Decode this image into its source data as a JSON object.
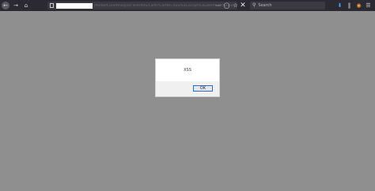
{
  "toolbar": {
    "back_icon": "arrow-left-icon",
    "forward_icon": "arrow-right-icon",
    "home_icon": "home-icon",
    "url_text": "/Portal/Core/Analysis/Test/XSS/Cart/?CartId=XSS%3Cscript%3Ealert%28%22xss%22%29%3C%2Fscript%3E",
    "search_placeholder": "Search",
    "accent_color": "#4aa3ff"
  },
  "dialog": {
    "message": "XSS",
    "ok_label": "OK"
  },
  "colors": {
    "page_background": "#8f8f8f",
    "toolbar_background": "#2b2a33"
  }
}
